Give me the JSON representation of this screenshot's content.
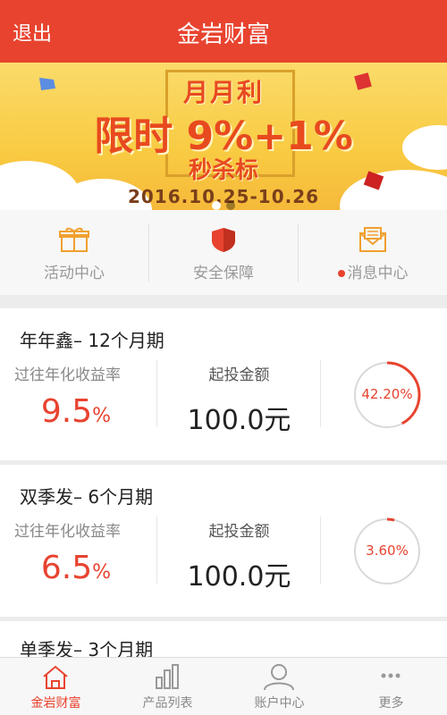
{
  "header": {
    "back_label": "退出",
    "title": "金岩财富"
  },
  "banner": {
    "line1": "月月利",
    "line2": "限时 9%+1%",
    "line3": "秒杀标",
    "date": "2016.10.25-10.26"
  },
  "quick_links": [
    {
      "label": "活动中心",
      "icon": "gift-icon"
    },
    {
      "label": "安全保障",
      "icon": "shield-icon"
    },
    {
      "label": "消息中心",
      "icon": "mail-icon"
    }
  ],
  "products": [
    {
      "name": "年年鑫– 12个月期",
      "rate_label": "过往年化收益率",
      "rate": "9.5",
      "rate_unit": "%",
      "amount_label": "起投金额",
      "amount": "100.0元",
      "progress_text": "42.20%",
      "progress": 0.422
    },
    {
      "name": "双季发– 6个月期",
      "rate_label": "过往年化收益率",
      "rate": "6.5",
      "rate_unit": "%",
      "amount_label": "起投金额",
      "amount": "100.0元",
      "progress_text": "3.60%",
      "progress": 0.036
    },
    {
      "name": "单季发– 3个月期"
    }
  ],
  "tabs": [
    {
      "label": "金岩财富",
      "icon": "home-icon",
      "active": true
    },
    {
      "label": "产品列表",
      "icon": "bar-chart-icon",
      "active": false
    },
    {
      "label": "账户中心",
      "icon": "user-icon",
      "active": false
    },
    {
      "label": "更多",
      "icon": "more-icon",
      "active": false
    }
  ],
  "colors": {
    "primary": "#e8432f",
    "banner": "#f8cb42"
  }
}
